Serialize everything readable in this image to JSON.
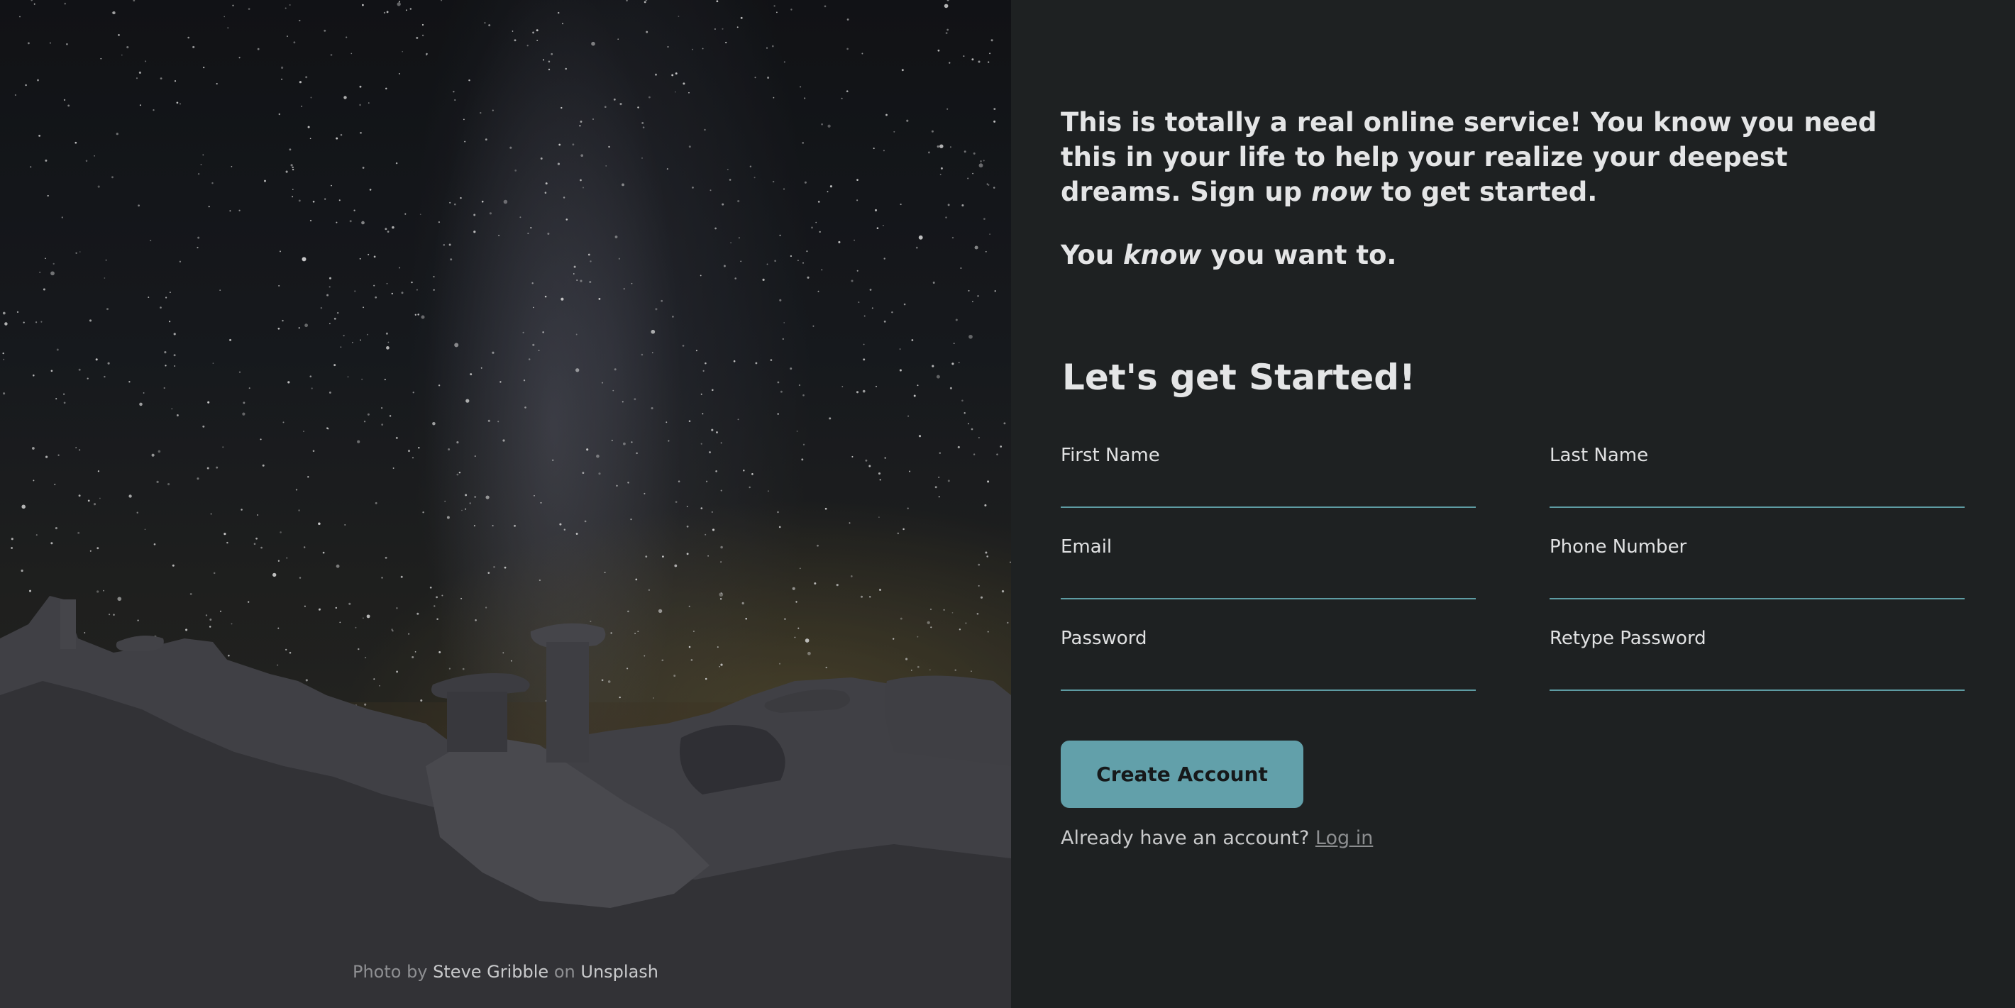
{
  "photo": {
    "credit_prefix": "Photo by",
    "author": "Steve Gribble",
    "credit_middle": "on",
    "source": "Unsplash"
  },
  "intro": {
    "line_part1": "This is totally a real online service! You know you need this in your life to help your realize your deepest dreams. Sign up",
    "line_emphasis": "now",
    "line_part2": "to get started.",
    "second_part1": "You",
    "second_emphasis": "know",
    "second_part2": "you want to."
  },
  "form": {
    "title": "Let's get Started!",
    "fields": {
      "first_name": {
        "label": "First Name",
        "value": ""
      },
      "last_name": {
        "label": "Last Name",
        "value": ""
      },
      "email": {
        "label": "Email",
        "value": ""
      },
      "phone": {
        "label": "Phone Number",
        "value": ""
      },
      "password": {
        "label": "Password",
        "value": ""
      },
      "retype_password": {
        "label": "Retype Password",
        "value": ""
      }
    },
    "submit_label": "Create Account",
    "login_prompt": "Already have an account?",
    "login_link": "Log in"
  },
  "colors": {
    "background": "#1e2122",
    "accent": "#62a0aa",
    "text": "#e4e5e6"
  }
}
